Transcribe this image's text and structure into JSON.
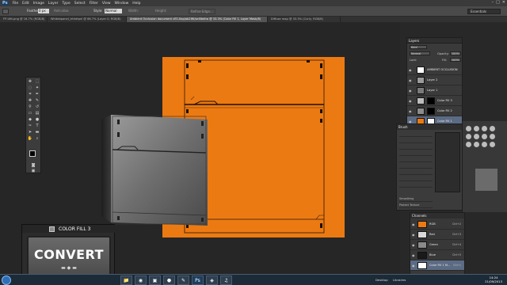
{
  "menubar": {
    "logo": "Ps",
    "items": [
      "File",
      "Edit",
      "Image",
      "Layer",
      "Type",
      "Select",
      "Filter",
      "View",
      "Window",
      "Help"
    ],
    "window_controls": [
      "–",
      "□",
      "✕"
    ]
  },
  "options": {
    "feather_label": "Feather:",
    "feather_value": "0 px",
    "antialias_label": "Anti-alias",
    "style_label": "Style:",
    "style_value": "Normal",
    "width_label": "Width:",
    "height_label": "Height:",
    "refine_label": "Refine Edge...",
    "workspace_value": "Essentials"
  },
  "tabs": [
    {
      "label": "FP-Ultt.png @ 16.7% (RGB/8)",
      "active": false
    },
    {
      "label": "Whitebpanel_trthetpnl @ 66.7% (Layer 0, RGB/8)",
      "active": false
    },
    {
      "label": "Ambient Occlusion document cE0.Xap/ob2WI/sel0bdha @ 33.3% (Color Fill 1, Layer Mask/8)",
      "active": true
    },
    {
      "label": "Diffuse map @ 33.3% (Curly, RGB/8)",
      "active": false
    }
  ],
  "colorfill": {
    "title": "COLOR FILL 3",
    "button_label": "CONVERT",
    "button_icons": "▬  ◆  ▬"
  },
  "layers_panel": {
    "tab_label": "Layers",
    "kind_label": "Kind",
    "blend_mode": "Normal",
    "opacity_label": "Opacity:",
    "opacity_value": "100%",
    "lock_label": "Lock:",
    "fill_label": "Fill:",
    "fill_value": "100%",
    "layers": [
      {
        "name": "AMBIENT OCCLUSION",
        "thumb": "#ffffff",
        "mask": false,
        "selected": false
      },
      {
        "name": "Layer 2",
        "thumb": "#9a9a9a",
        "mask": false,
        "selected": false
      },
      {
        "name": "Layer 1",
        "thumb": "#7a7a7a",
        "mask": false,
        "selected": false
      },
      {
        "name": "Color Fill 3",
        "thumb": "#bdbdbd",
        "mask": true,
        "selected": false
      },
      {
        "name": "Color Fill 2",
        "thumb": "#8c8c8c",
        "mask": true,
        "selected": false
      },
      {
        "name": "Color Fill 1",
        "thumb": "#ec7a12",
        "mask": true,
        "selected": true
      }
    ]
  },
  "brushes_panel": {
    "tab_label": "Brush",
    "rows": [
      "",
      "",
      "",
      "",
      "",
      "",
      "",
      "",
      "",
      "Smoothing",
      "Protect Texture"
    ]
  },
  "channels_panel": {
    "tab_label": "Channels",
    "rows": [
      {
        "name": "RGB",
        "shortcut": "Ctrl+2",
        "thumb": "#ec7a12",
        "selected": false
      },
      {
        "name": "Red",
        "shortcut": "Ctrl+3",
        "thumb": "#d8d8d8",
        "selected": false
      },
      {
        "name": "Green",
        "shortcut": "Ctrl+4",
        "thumb": "#8a8a8a",
        "selected": false
      },
      {
        "name": "Blue",
        "shortcut": "Ctrl+5",
        "thumb": "#1a1a1a",
        "selected": false
      },
      {
        "name": "Color Fill 1 M...",
        "shortcut": "Ctrl+\\",
        "thumb": "#ffffff",
        "selected": true
      }
    ]
  },
  "taskbar": {
    "apps": [
      "📁",
      "◉",
      "▣",
      "⬣",
      "✎",
      "Ps",
      "◈",
      "♫"
    ],
    "desktop_label": "Desktop",
    "libraries_label": "Libraries",
    "time": "14:24",
    "date": "21/09/2013"
  },
  "colors": {
    "canvas_orange": "#ec7a12",
    "panel_bg": "#3a3a3a",
    "selection_blue": "#5c6b84"
  }
}
